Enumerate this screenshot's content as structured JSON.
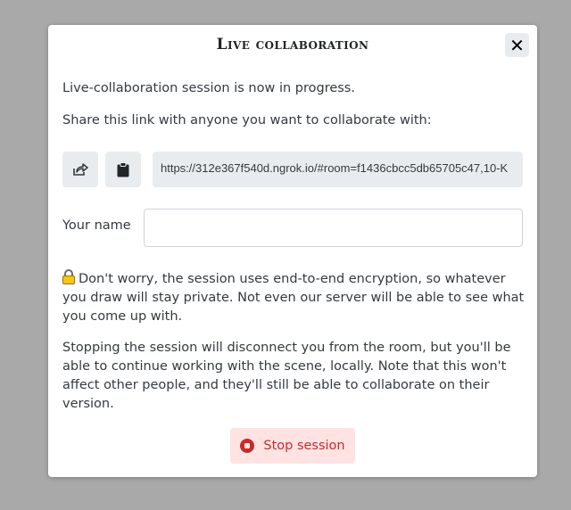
{
  "dialog": {
    "title": "Live collaboration",
    "close_label": "✕",
    "intro": "Live-collaboration session is now in progress.",
    "share_prompt": "Share this link with anyone you want to collaborate with:",
    "link": "https://312e367f540d.ngrok.io/#room=f1436cbcc5db65705c47,10-K",
    "name_label": "Your name",
    "name_value": "",
    "encryption_note": "Don't worry, the session uses end-to-end encryption, so whatever you draw will stay private. Not even our server will be able to see what you come up with.",
    "stop_note": "Stopping the session will disconnect you from the room, but you'll be able to continue working with the scene, locally. Note that this won't affect other people, and they'll still be able to collaborate on their version.",
    "stop_button_label": "Stop session"
  },
  "icons": {
    "share": "share-icon",
    "copy": "clipboard-icon",
    "lock": "lock-icon",
    "stop": "stop-icon",
    "close": "close-icon"
  },
  "colors": {
    "backdrop": "#aaaaaa",
    "button_bg": "#e9ecef",
    "danger": "#c92a2a",
    "danger_bg": "#ffe3e3"
  }
}
